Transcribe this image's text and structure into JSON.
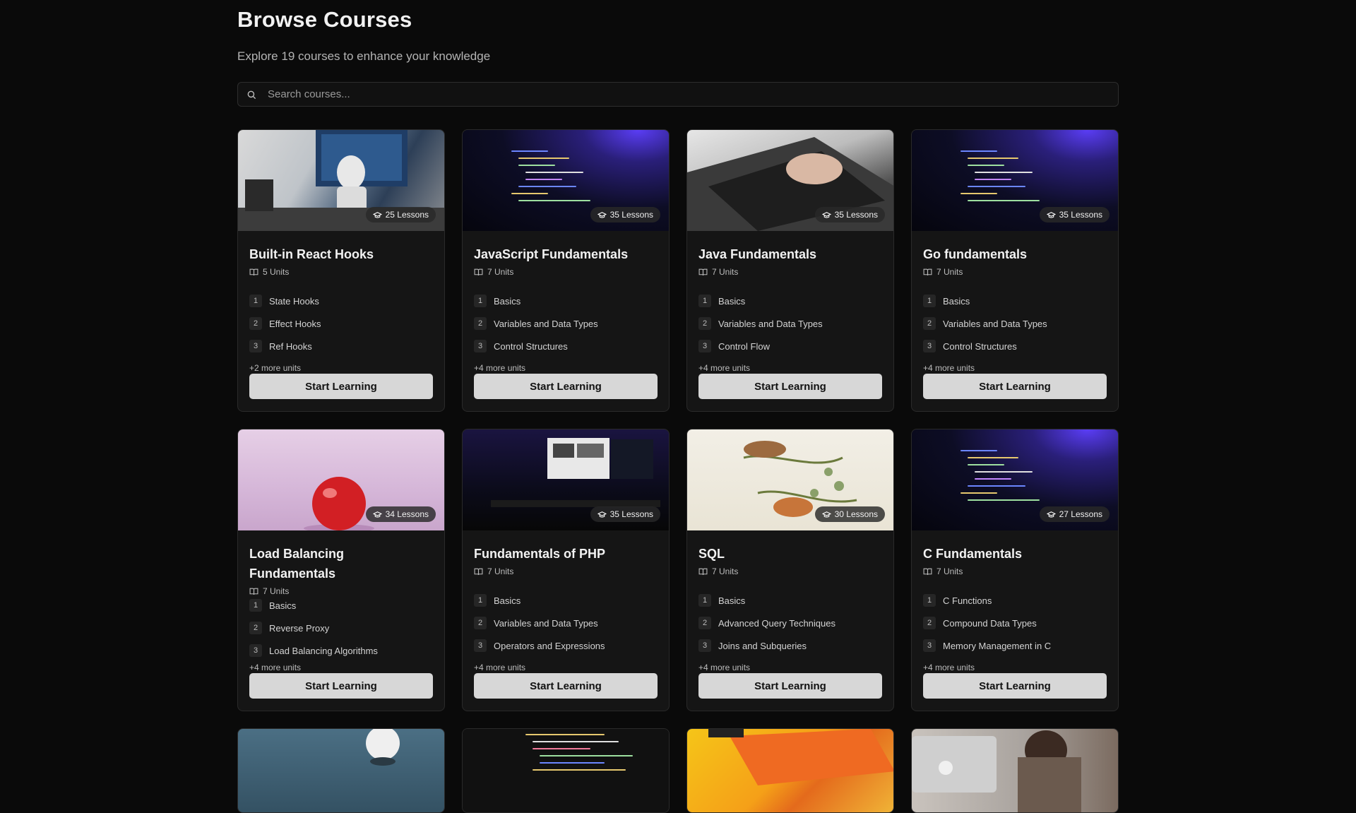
{
  "header": {
    "title": "Browse Courses",
    "subtitle": "Explore 19 courses to enhance your knowledge"
  },
  "search": {
    "placeholder": "Search courses...",
    "value": ""
  },
  "start_label": "Start Learning",
  "courses": [
    {
      "title": "Built-in React Hooks",
      "lessons": "25 Lessons",
      "units": "5 Units",
      "unit_items": [
        {
          "n": "1",
          "label": "State Hooks"
        },
        {
          "n": "2",
          "label": "Effect Hooks"
        },
        {
          "n": "3",
          "label": "Ref Hooks"
        }
      ],
      "more": "+2 more units"
    },
    {
      "title": "JavaScript Fundamentals",
      "lessons": "35 Lessons",
      "units": "7 Units",
      "unit_items": [
        {
          "n": "1",
          "label": "Basics"
        },
        {
          "n": "2",
          "label": "Variables and Data Types"
        },
        {
          "n": "3",
          "label": "Control Structures"
        }
      ],
      "more": "+4 more units"
    },
    {
      "title": "Java Fundamentals",
      "lessons": "35 Lessons",
      "units": "7 Units",
      "unit_items": [
        {
          "n": "1",
          "label": "Basics"
        },
        {
          "n": "2",
          "label": "Variables and Data Types"
        },
        {
          "n": "3",
          "label": "Control Flow"
        }
      ],
      "more": "+4 more units"
    },
    {
      "title": "Go fundamentals",
      "lessons": "35 Lessons",
      "units": "7 Units",
      "unit_items": [
        {
          "n": "1",
          "label": "Basics"
        },
        {
          "n": "2",
          "label": "Variables and Data Types"
        },
        {
          "n": "3",
          "label": "Control Structures"
        }
      ],
      "more": "+4 more units"
    },
    {
      "title": "Load Balancing Fundamentals",
      "lessons": "34 Lessons",
      "units": "7 Units",
      "unit_items": [
        {
          "n": "1",
          "label": "Basics"
        },
        {
          "n": "2",
          "label": "Reverse Proxy"
        },
        {
          "n": "3",
          "label": "Load Balancing Algorithms"
        }
      ],
      "more": "+4 more units"
    },
    {
      "title": "Fundamentals of PHP",
      "lessons": "35 Lessons",
      "units": "7 Units",
      "unit_items": [
        {
          "n": "1",
          "label": "Basics"
        },
        {
          "n": "2",
          "label": "Variables and Data Types"
        },
        {
          "n": "3",
          "label": "Operators and Expressions"
        }
      ],
      "more": "+4 more units"
    },
    {
      "title": "SQL",
      "lessons": "30 Lessons",
      "units": "7 Units",
      "unit_items": [
        {
          "n": "1",
          "label": "Basics"
        },
        {
          "n": "2",
          "label": "Advanced Query Techniques"
        },
        {
          "n": "3",
          "label": "Joins and Subqueries"
        }
      ],
      "more": "+4 more units"
    },
    {
      "title": "C Fundamentals",
      "lessons": "27 Lessons",
      "units": "7 Units",
      "unit_items": [
        {
          "n": "1",
          "label": "C Functions"
        },
        {
          "n": "2",
          "label": "Compound Data Types"
        },
        {
          "n": "3",
          "label": "Memory Management in C"
        }
      ],
      "more": "+4 more units"
    }
  ]
}
